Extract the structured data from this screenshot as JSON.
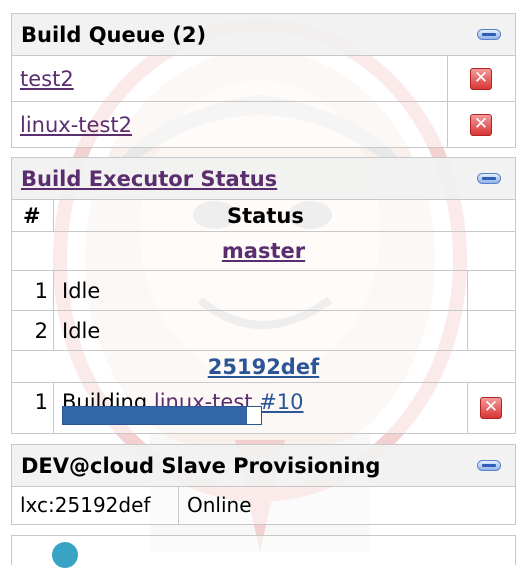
{
  "build_queue": {
    "title": "Build Queue (2)",
    "items": [
      {
        "label": "test2"
      },
      {
        "label": "linux-test2"
      }
    ]
  },
  "executor_status": {
    "title": "Build Executor Status",
    "col_num": "#",
    "col_status": "Status",
    "nodes": [
      {
        "name": "master",
        "executors": [
          {
            "num": "1",
            "status": "Idle"
          },
          {
            "num": "2",
            "status": "Idle"
          }
        ]
      },
      {
        "name": "25192def",
        "executors": [
          {
            "num": "1",
            "status": "Building",
            "job": "linux-test",
            "build": "#10",
            "progress": 0.93
          }
        ]
      }
    ]
  },
  "slave_provisioning": {
    "title": "DEV@cloud Slave Provisioning",
    "rows": [
      {
        "name": "lxc:25192def",
        "state": "Online"
      }
    ]
  },
  "colors": {
    "link": "#5a2e6e",
    "header_bg": "#f0f0f0",
    "border": "#c8c8c8",
    "progress": "#3366a8",
    "cancel": "#d93636"
  }
}
